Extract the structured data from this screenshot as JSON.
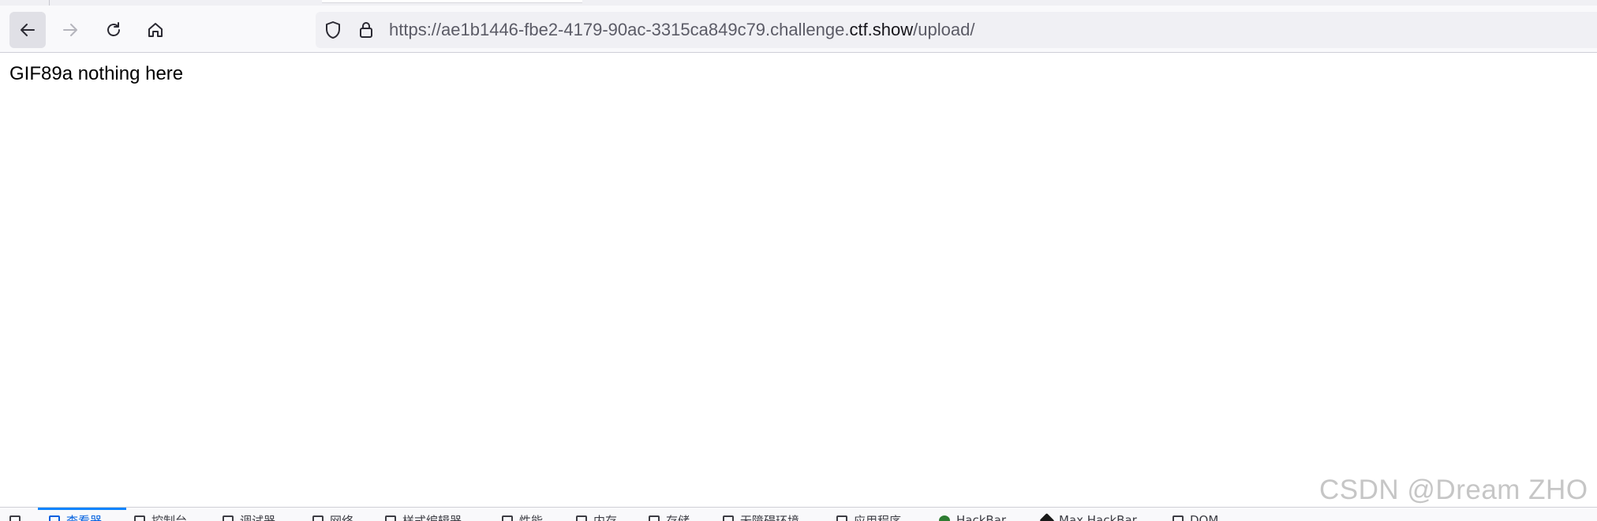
{
  "browser": {
    "url": {
      "prefix": "https://ae1b1446-fbe2-4179-90ac-3315ca849c79.challenge.",
      "domain": "ctf.show",
      "path": "/upload/"
    }
  },
  "page": {
    "text": "GIF89a nothing here"
  },
  "watermark": {
    "text": "CSDN @Dream ZHO"
  },
  "devtools": {
    "tabs": [
      {
        "label": "查看器",
        "active": true
      },
      {
        "label": "控制台",
        "active": false
      },
      {
        "label": "调试器",
        "active": false
      },
      {
        "label": "网络",
        "active": false
      },
      {
        "label": "样式编辑器",
        "active": false
      },
      {
        "label": "性能",
        "active": false
      },
      {
        "label": "内存",
        "active": false
      },
      {
        "label": "存储",
        "active": false
      },
      {
        "label": "无障碍环境",
        "active": false
      },
      {
        "label": "应用程序",
        "active": false
      },
      {
        "label": "HackBar",
        "active": false
      },
      {
        "label": "Max HackBar",
        "active": false
      },
      {
        "label": "DOM",
        "active": false
      }
    ]
  },
  "colors": {
    "accent": "#0060df",
    "toolbar_bg": "#f9f9fb",
    "urlbar_bg": "#f0f0f4"
  }
}
